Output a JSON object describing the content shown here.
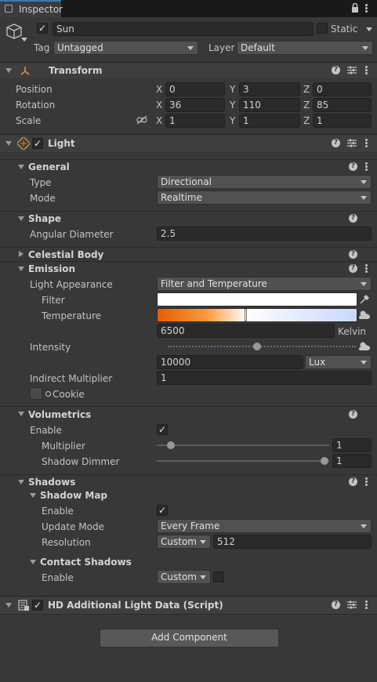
{
  "window": {
    "tab_title": "Inspector"
  },
  "object": {
    "name": "Sun",
    "static_label": "Static",
    "tag_label": "Tag",
    "tag_value": "Untagged",
    "layer_label": "Layer",
    "layer_value": "Default"
  },
  "transform": {
    "title": "Transform",
    "position_label": "Position",
    "rotation_label": "Rotation",
    "scale_label": "Scale",
    "axis_x": "X",
    "axis_y": "Y",
    "axis_z": "Z",
    "position": [
      "0",
      "3",
      "0"
    ],
    "rotation": [
      "36",
      "110",
      "85"
    ],
    "scale": [
      "1",
      "1",
      "1"
    ]
  },
  "light": {
    "title": "Light",
    "general": {
      "title": "General",
      "type_label": "Type",
      "type_value": "Directional",
      "mode_label": "Mode",
      "mode_value": "Realtime"
    },
    "shape": {
      "title": "Shape",
      "angular_label": "Angular Diameter",
      "angular_value": "2.5"
    },
    "celestial": {
      "title": "Celestial Body"
    },
    "emission": {
      "title": "Emission",
      "appearance_label": "Light Appearance",
      "appearance_value": "Filter and Temperature",
      "filter_label": "Filter",
      "temperature_label": "Temperature",
      "temperature_value": "6500",
      "temperature_unit": "Kelvin",
      "temperature_gradient": {
        "start": "#e85c00",
        "mid": "#ffffff",
        "end": "#c8d8ff"
      },
      "intensity_label": "Intensity",
      "intensity_value": "10000",
      "intensity_unit": "Lux",
      "intensity_slider_fraction": 0.5,
      "indirect_label": "Indirect Multiplier",
      "indirect_value": "1",
      "cookie_label": "Cookie",
      "filter_color": "#ffffff"
    },
    "volumetrics": {
      "title": "Volumetrics",
      "enable_label": "Enable",
      "enable_checked": true,
      "multiplier_label": "Multiplier",
      "multiplier_value": "1",
      "multiplier_slider_fraction": 0.06,
      "dimmer_label": "Shadow Dimmer",
      "dimmer_value": "1",
      "dimmer_slider_fraction": 1.0
    },
    "shadows": {
      "title": "Shadows",
      "shadow_map_title": "Shadow Map",
      "enable_label": "Enable",
      "enable_checked": true,
      "update_label": "Update Mode",
      "update_value": "Every Frame",
      "resolution_label": "Resolution",
      "resolution_preset": "Custom",
      "resolution_value": "512",
      "contact_title": "Contact Shadows",
      "contact_enable_label": "Enable",
      "contact_preset": "Custom"
    }
  },
  "hd_data": {
    "title": "HD Additional Light Data (Script)"
  },
  "add_component": {
    "label": "Add Component"
  },
  "icons": {
    "lock": "lock-icon",
    "menu": "kebab-menu-icon",
    "help": "help-icon",
    "preset": "preset-icon",
    "gameobject": "cube-icon",
    "transform": "transform-axes-icon",
    "light": "light-icon",
    "script": "script-icon",
    "eyedropper": "eyedropper-icon",
    "weather": "weather-icon",
    "link": "link-icon"
  },
  "colors": {
    "accent": "#e85c00",
    "bg": "#383838",
    "header": "#3e3e3e"
  }
}
